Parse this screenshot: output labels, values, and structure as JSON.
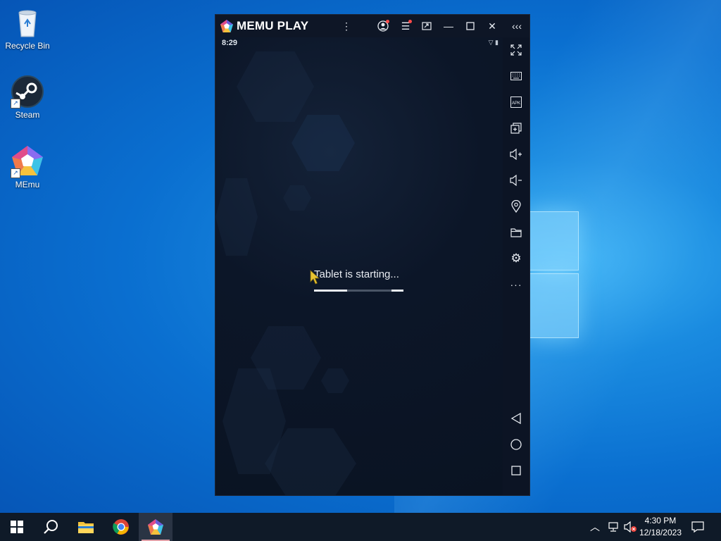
{
  "desktop": {
    "icons": [
      {
        "label": "Recycle Bin"
      },
      {
        "label": "Steam"
      },
      {
        "label": "MEmu"
      }
    ]
  },
  "memu": {
    "brand": "MEMU PLAY",
    "status_time": "8:29",
    "loading_text": "Tablet is starting...",
    "progress_fraction": 0.37,
    "titlebar_buttons": [
      "more-vert-icon",
      "account-icon",
      "menu-icon",
      "screen-cast-icon",
      "minimize-icon",
      "maximize-icon",
      "close-icon",
      "collapse-sidebar-icon"
    ],
    "sidebar_icons": [
      "fullscreen-icon",
      "keyboard-icon",
      "apk-icon",
      "multi-instance-icon",
      "volume-up-icon",
      "volume-down-icon",
      "location-icon",
      "folder-icon",
      "settings-icon",
      "more-icon",
      "back-icon",
      "home-icon",
      "recents-icon"
    ]
  },
  "taskbar": {
    "apps": [
      "start-icon",
      "search-icon",
      "file-explorer-icon",
      "chrome-icon",
      "memu-icon"
    ],
    "clock_time": "4:30 PM",
    "clock_date": "12/18/2023"
  }
}
